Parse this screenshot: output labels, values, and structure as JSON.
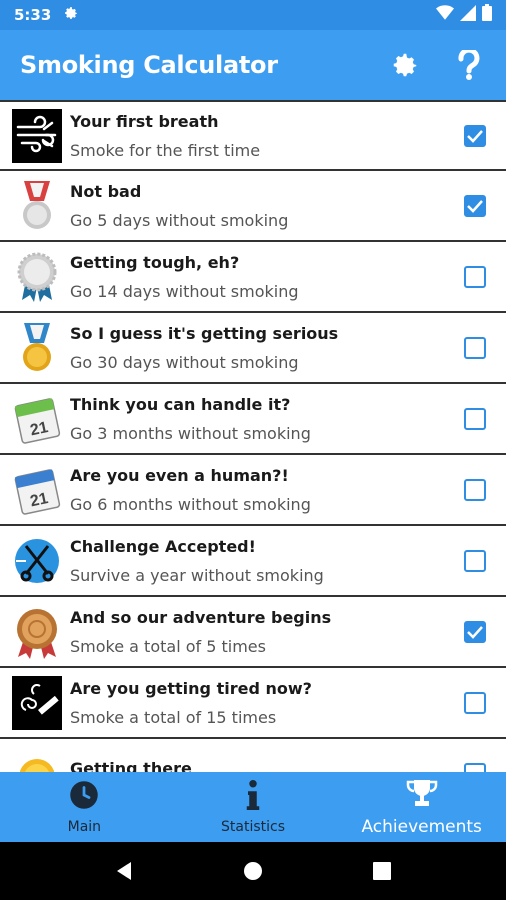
{
  "status_bar": {
    "time": "5:33",
    "icons": [
      "gear-icon",
      "wifi-icon",
      "signal-icon",
      "battery-icon"
    ]
  },
  "app_bar": {
    "title": "Smoking Calculator",
    "actions": [
      "settings-icon",
      "help-icon"
    ]
  },
  "achievements": [
    {
      "title": "Your first breath",
      "desc": "Smoke for the first time",
      "checked": true,
      "icon": "wind-icon"
    },
    {
      "title": "Not bad",
      "desc": "Go 5 days without smoking",
      "checked": true,
      "icon": "silver-medal-icon"
    },
    {
      "title": "Getting tough, eh?",
      "desc": "Go 14 days without smoking",
      "checked": false,
      "icon": "rosette-icon"
    },
    {
      "title": "So I guess it's getting serious",
      "desc": "Go 30 days without smoking",
      "checked": false,
      "icon": "gold-medal-icon"
    },
    {
      "title": "Think you can handle it?",
      "desc": "Go 3 months without smoking",
      "checked": false,
      "icon": "calendar-green-icon"
    },
    {
      "title": "Are you even a human?!",
      "desc": "Go 6 months without smoking",
      "checked": false,
      "icon": "calendar-blue-icon"
    },
    {
      "title": "Challenge Accepted!",
      "desc": "Survive a year without smoking",
      "checked": false,
      "icon": "scissors-icon"
    },
    {
      "title": "And so our adventure begins",
      "desc": "Smoke a total of 5 times",
      "checked": true,
      "icon": "bronze-medal-icon"
    },
    {
      "title": "Are you getting tired now?",
      "desc": "Smoke a total of 15 times",
      "checked": false,
      "icon": "cigarette-smoke-icon"
    },
    {
      "title": "Getting there",
      "desc": "",
      "checked": false,
      "icon": "sun-icon"
    }
  ],
  "bottom_nav": {
    "tabs": [
      {
        "label": "Main",
        "icon": "clock-icon",
        "active": false
      },
      {
        "label": "Statistics",
        "icon": "info-icon",
        "active": false
      },
      {
        "label": "Achievements",
        "icon": "trophy-icon",
        "active": true
      }
    ]
  },
  "system_nav": [
    "back-icon",
    "home-icon",
    "recents-icon"
  ],
  "colors": {
    "primary": "#3d9df0",
    "status_bar": "#2f8ee3",
    "checkbox": "#2f8ee3"
  }
}
